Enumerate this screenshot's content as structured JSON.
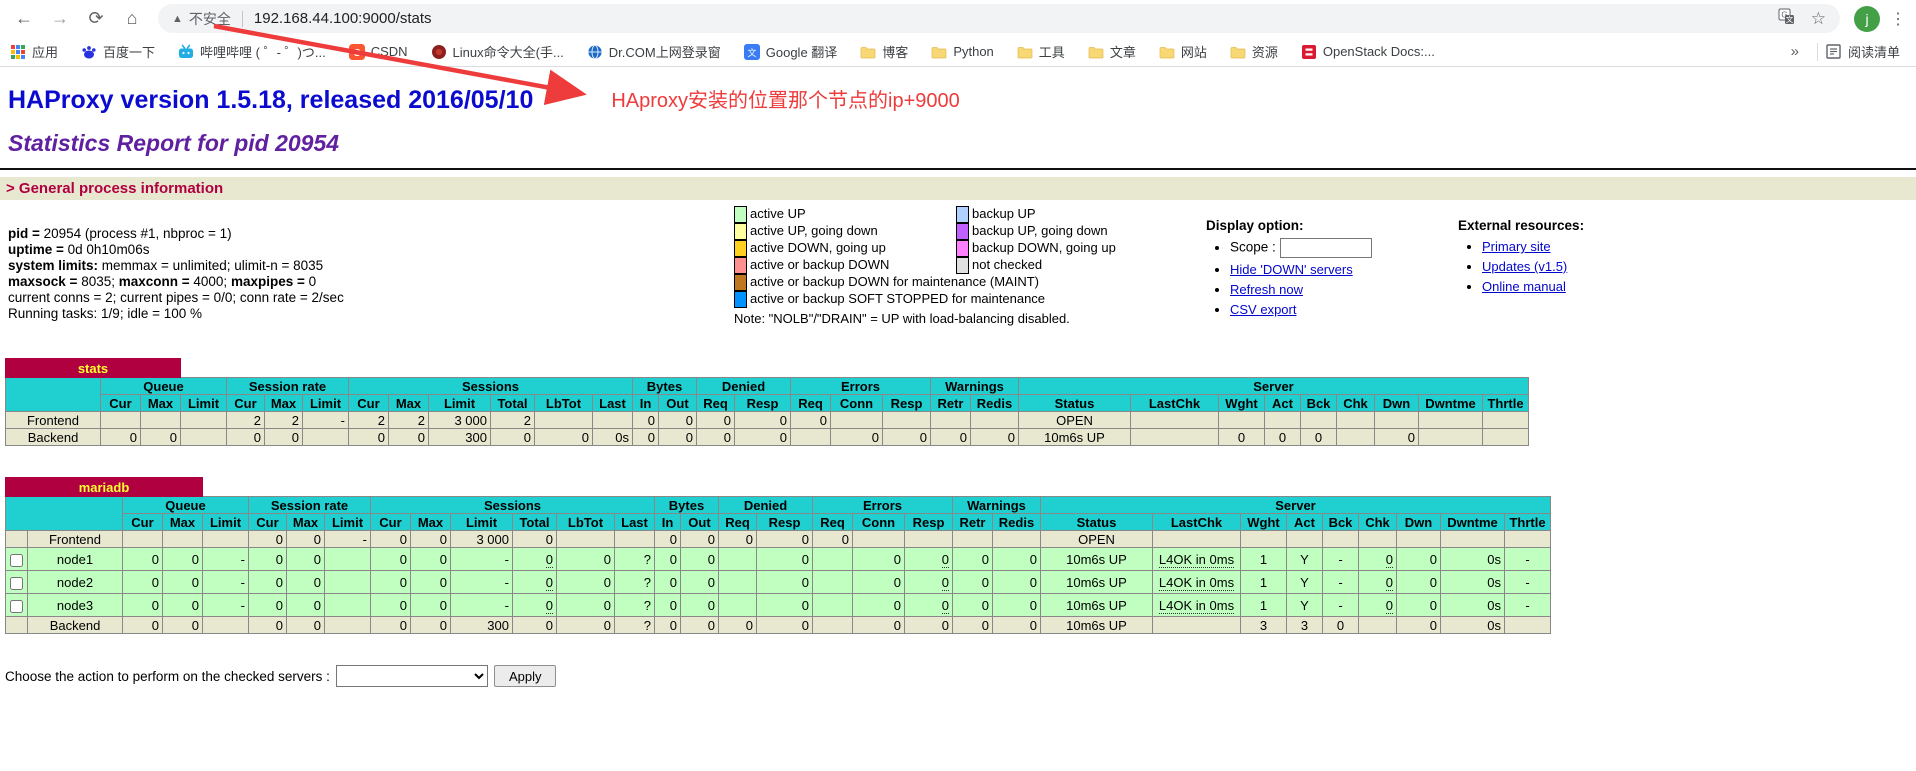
{
  "browser": {
    "toolbar": {
      "security_label": "不安全",
      "url": "192.168.44.100:9000/stats",
      "avatar_letter": "j"
    },
    "bookmarks": [
      {
        "label": "应用",
        "icon": "apps-grid"
      },
      {
        "label": "百度一下",
        "icon": "baidu-paw"
      },
      {
        "label": "哔哩哔哩 ( ゜- ゜)つ...",
        "icon": "bilibili"
      },
      {
        "label": "CSDN",
        "icon": "csdn"
      },
      {
        "label": "Linux命令大全(手...",
        "icon": "linux"
      },
      {
        "label": "Dr.COM上网登录窗",
        "icon": "globe"
      },
      {
        "label": "Google 翻译",
        "icon": "translate"
      },
      {
        "label": "博客",
        "icon": "folder"
      },
      {
        "label": "Python",
        "icon": "folder"
      },
      {
        "label": "工具",
        "icon": "folder"
      },
      {
        "label": "文章",
        "icon": "folder"
      },
      {
        "label": "网站",
        "icon": "folder"
      },
      {
        "label": "资源",
        "icon": "folder"
      },
      {
        "label": "OpenStack Docs:...",
        "icon": "openstack"
      }
    ],
    "bookmarks_overflow": "»",
    "reading_list_label": "阅读清单"
  },
  "header": {
    "title": "HAProxy version 1.5.18, released 2016/05/10",
    "annotation": "HAproxy安装的位置那个节点的ip+9000",
    "subtitle": "Statistics Report for pid 20954",
    "section_title": "> General process information"
  },
  "process_info": {
    "lines": [
      [
        {
          "b": "pid = "
        },
        {
          "t": "20954 (process #1, nbproc = 1)"
        }
      ],
      [
        {
          "b": "uptime = "
        },
        {
          "t": "0d 0h10m06s"
        }
      ],
      [
        {
          "b": "system limits: "
        },
        {
          "t": "memmax = unlimited; ulimit-n = 8035"
        }
      ],
      [
        {
          "b": "maxsock = "
        },
        {
          "t": "8035; "
        },
        {
          "b": "maxconn = "
        },
        {
          "t": "4000; "
        },
        {
          "b": "maxpipes = "
        },
        {
          "t": "0"
        }
      ],
      [
        {
          "t": "current conns = 2; current pipes = 0/0; conn rate = 2/sec"
        }
      ],
      [
        {
          "t": "Running tasks: 1/9; idle = 100 %"
        }
      ]
    ]
  },
  "legend": {
    "pairs": [
      {
        "color": "#c0ffc0",
        "label": "active UP",
        "color2": "#b0d0ff",
        "label2": "backup UP"
      },
      {
        "color": "#ffffa0",
        "label": "active UP, going down",
        "color2": "#c060ff",
        "label2": "backup UP, going down"
      },
      {
        "color": "#ffd020",
        "label": "active DOWN, going up",
        "color2": "#ff80ff",
        "label2": "backup DOWN, going up"
      },
      {
        "color": "#ff9090",
        "label": "active or backup DOWN",
        "color2": "#e0e0e0",
        "label2": "not checked"
      }
    ],
    "full": [
      {
        "color": "#c07820",
        "label": "active or backup DOWN for maintenance (MAINT)"
      },
      {
        "color": "#0092ff",
        "label": "active or backup SOFT STOPPED for maintenance"
      }
    ],
    "note": "Note: \"NOLB\"/\"DRAIN\" = UP with load-balancing disabled."
  },
  "display_option": {
    "title": "Display option:",
    "scope_label": "Scope :",
    "links": [
      "Hide 'DOWN' servers",
      "Refresh now",
      "CSV export"
    ]
  },
  "external_resources": {
    "title": "External resources:",
    "links": [
      "Primary site",
      "Updates (v1.5)",
      "Online manual"
    ]
  },
  "table_columns": {
    "groups": [
      {
        "label": "Queue",
        "span": 3
      },
      {
        "label": "Session rate",
        "span": 3
      },
      {
        "label": "Sessions",
        "span": 6
      },
      {
        "label": "Bytes",
        "span": 2
      },
      {
        "label": "Denied",
        "span": 2
      },
      {
        "label": "Errors",
        "span": 3
      },
      {
        "label": "Warnings",
        "span": 2
      },
      {
        "label": "Server",
        "span": 9
      }
    ],
    "sub": [
      "Cur",
      "Max",
      "Limit",
      "Cur",
      "Max",
      "Limit",
      "Cur",
      "Max",
      "Limit",
      "Total",
      "LbTot",
      "Last",
      "In",
      "Out",
      "Req",
      "Resp",
      "Req",
      "Conn",
      "Resp",
      "Retr",
      "Redis",
      "Status",
      "LastChk",
      "Wght",
      "Act",
      "Bck",
      "Chk",
      "Dwn",
      "Dwntme",
      "Thrtle"
    ],
    "aligns": [
      "r",
      "r",
      "r",
      "r",
      "r",
      "r",
      "r",
      "r",
      "r",
      "r",
      "r",
      "r",
      "r",
      "r",
      "r",
      "r",
      "r",
      "r",
      "r",
      "r",
      "r",
      "c",
      "c",
      "c",
      "c",
      "c",
      "r",
      "r",
      "r",
      "c"
    ]
  },
  "proxy_tables": [
    {
      "name": "stats",
      "has_checkbox": false,
      "rows": [
        {
          "name": "Frontend",
          "type": "frontend",
          "checkbox": false,
          "cells": [
            "",
            "",
            "",
            "2^",
            "2^",
            "-",
            "2",
            "2",
            "3 000",
            "2^",
            "",
            "",
            "0",
            "0",
            "0",
            "0",
            "0",
            "",
            "",
            "",
            "",
            "OPEN",
            "",
            "",
            "",
            "",
            "",
            "",
            "",
            ""
          ]
        },
        {
          "name": "Backend",
          "type": "backend",
          "checkbox": false,
          "cells": [
            "0",
            "0",
            "",
            "0",
            "0",
            "",
            "0",
            "0",
            "300",
            "0^",
            "0",
            "0s",
            "0",
            "0",
            "0",
            "0",
            "",
            "0",
            "0^",
            "0",
            "0",
            "10m6s UP",
            "",
            "0",
            "0",
            "0",
            "",
            "0",
            "",
            ""
          ]
        }
      ]
    },
    {
      "name": "mariadb",
      "has_checkbox": true,
      "rows": [
        {
          "name": "Frontend",
          "type": "frontend",
          "checkbox": false,
          "cells": [
            "",
            "",
            "",
            "0^",
            "0^",
            "-",
            "0",
            "0",
            "3 000",
            "0^",
            "",
            "",
            "0",
            "0",
            "0",
            "0",
            "0",
            "",
            "",
            "",
            "",
            "OPEN",
            "",
            "",
            "",
            "",
            "",
            "",
            "",
            ""
          ]
        },
        {
          "name": "node1",
          "type": "server-up",
          "checkbox": true,
          "cells": [
            "0",
            "0",
            "-",
            "0",
            "0",
            "",
            "0",
            "0",
            "-",
            "0^",
            "0",
            "?",
            "0",
            "0",
            "",
            "0",
            "",
            "0",
            "0^",
            "0",
            "0",
            "10m6s UP",
            "L4OK in 0ms^",
            "1",
            "Y",
            "-",
            "0^",
            "0",
            "0s",
            "-"
          ]
        },
        {
          "name": "node2",
          "type": "server-up",
          "checkbox": true,
          "cells": [
            "0",
            "0",
            "-",
            "0",
            "0",
            "",
            "0",
            "0",
            "-",
            "0^",
            "0",
            "?",
            "0",
            "0",
            "",
            "0",
            "",
            "0",
            "0^",
            "0",
            "0",
            "10m6s UP",
            "L4OK in 0ms^",
            "1",
            "Y",
            "-",
            "0^",
            "0",
            "0s",
            "-"
          ]
        },
        {
          "name": "node3",
          "type": "server-up",
          "checkbox": true,
          "cells": [
            "0",
            "0",
            "-",
            "0",
            "0",
            "",
            "0",
            "0",
            "-",
            "0^",
            "0",
            "?",
            "0",
            "0",
            "",
            "0",
            "",
            "0",
            "0^",
            "0",
            "0",
            "10m6s UP",
            "L4OK in 0ms^",
            "1",
            "Y",
            "-",
            "0^",
            "0",
            "0s",
            "-"
          ]
        },
        {
          "name": "Backend",
          "type": "backend",
          "checkbox": false,
          "cells": [
            "0",
            "0",
            "",
            "0",
            "0",
            "",
            "0",
            "0",
            "300",
            "0^",
            "0",
            "?",
            "0",
            "0",
            "0",
            "0",
            "",
            "0",
            "0",
            "0",
            "0",
            "10m6s UP",
            "",
            "3",
            "3",
            "0",
            "",
            "0",
            "0s",
            ""
          ]
        }
      ]
    }
  ],
  "action_bar": {
    "label": "Choose the action to perform on the checked servers :",
    "apply_label": "Apply"
  },
  "colors": {
    "pxname_bg": "#b00040",
    "pxname_fg": "#ffff30",
    "header_bg": "#20d0d0",
    "row_bg": "#e8e8d0",
    "active_up_bg": "#c0ffc0",
    "annotation_red": "#ee3b3b",
    "title_blue": "#0b0bd0",
    "subtitle_purple": "#6020a0",
    "section_maroon": "#b00040"
  }
}
